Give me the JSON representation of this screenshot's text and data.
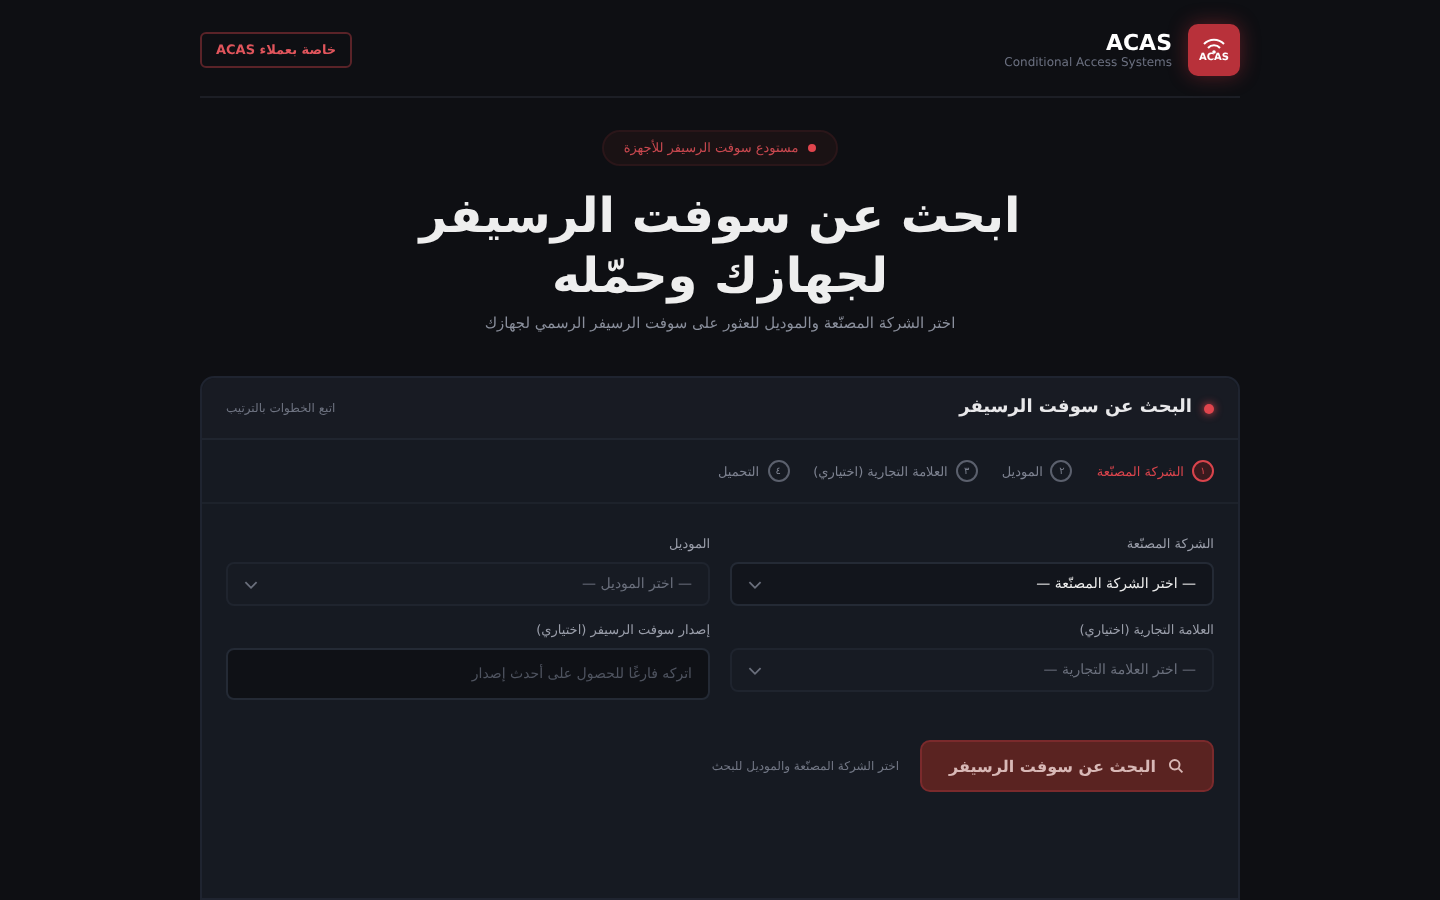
{
  "header": {
    "logo_text": "ACAS",
    "brand": "ACAS",
    "tagline": "Conditional Access Systems",
    "badge": "خاصة بعملاء ACAS"
  },
  "hero": {
    "eyebrow": "مستودع سوفت الرسيفر للأجهزة",
    "title_lines": [
      "ابحث عن سوفت الرسيفر",
      "لجهازك وحمّله"
    ],
    "subtitle": "اختر الشركة المصنّعة والموديل للعثور على سوفت الرسيفر الرسمي لجهازك"
  },
  "card": {
    "title": "البحث عن سوفت الرسيفر",
    "hint": "اتبع الخطوات بالترتيب",
    "steps": [
      {
        "number": "١",
        "label": "الشركة المصنّعة",
        "selected": true
      },
      {
        "number": "٢",
        "label": "الموديل",
        "selected": false
      },
      {
        "number": "٣",
        "label": "العلامة التجارية (اختياري)",
        "selected": false
      },
      {
        "number": "٤",
        "label": "التحميل",
        "selected": false
      }
    ],
    "fields": [
      {
        "kind": "select",
        "label": "الشركة المصنّعة",
        "value": "— اختر الشركة المصنّعة —",
        "disabled": false
      },
      {
        "kind": "select",
        "label": "الموديل",
        "value": "— اختر الموديل —",
        "disabled": true
      },
      {
        "kind": "select",
        "label": "العلامة التجارية (اختياري)",
        "value": "— اختر العلامة التجارية —",
        "disabled": true
      },
      {
        "kind": "text",
        "label": "إصدار سوفت الرسيفر (اختياري)",
        "placeholder": "اتركه فارغًا للحصول على أحدث إصدار"
      }
    ],
    "search_button": {
      "label": "البحث عن سوفت الرسيفر",
      "disabled": true
    },
    "search_hint": "اختر الشركة المصنّعة والموديل للبحث"
  }
}
